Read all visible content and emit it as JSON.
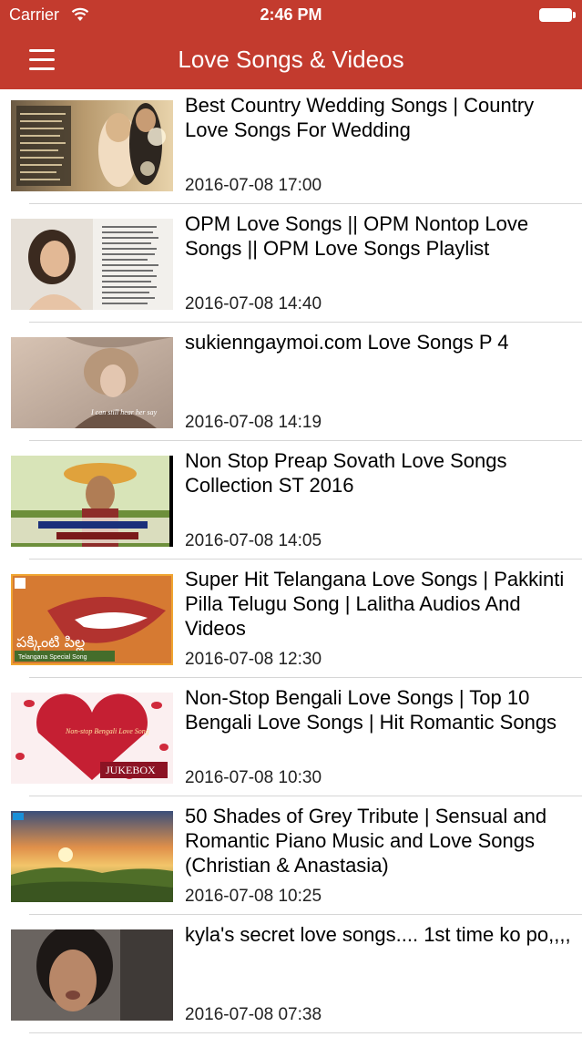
{
  "status_bar": {
    "carrier": "Carrier",
    "time": "2:46 PM"
  },
  "nav": {
    "title": "Love Songs & Videos",
    "menu_icon": "hamburger-menu-icon",
    "bar_color": "#c33b2e"
  },
  "videos": [
    {
      "title": "Best Country Wedding Songs | Country Love Songs For Wedding",
      "date": "2016-07-08 17:00"
    },
    {
      "title": "OPM Love Songs || OPM Nontop Love Songs || OPM Love Songs Playlist",
      "date": "2016-07-08 14:40"
    },
    {
      "title": "sukienngaymoi.com Love Songs P 4",
      "date": "2016-07-08 14:19",
      "thumb_caption": "I can still hear her say"
    },
    {
      "title": "Non Stop Preap Sovath   Love Songs Collection ST 2016",
      "date": "2016-07-08 14:05"
    },
    {
      "title": "Super Hit Telangana Love Songs | Pakkinti Pilla Telugu Song | Lalitha Audios And Videos",
      "date": "2016-07-08 12:30",
      "thumb_caption": "పక్కింటి పిల్ల",
      "thumb_subcaption": "Telangana Special Song"
    },
    {
      "title": "Non-Stop Bengali Love Songs | Top 10 Bengali Love Songs | Hit Romantic Songs",
      "date": "2016-07-08 10:30",
      "thumb_caption": "JUKEBOX",
      "thumb_subcaption": "Non-stop Bengali Love Song"
    },
    {
      "title": "50 Shades of Grey Tribute | Sensual and Romantic Piano Music and Love Songs (Christian & Anastasia)",
      "date": "2016-07-08 10:25"
    },
    {
      "title": "kyla's secret love songs.... 1st time ko po,,,,",
      "date": "2016-07-08 07:38"
    }
  ]
}
